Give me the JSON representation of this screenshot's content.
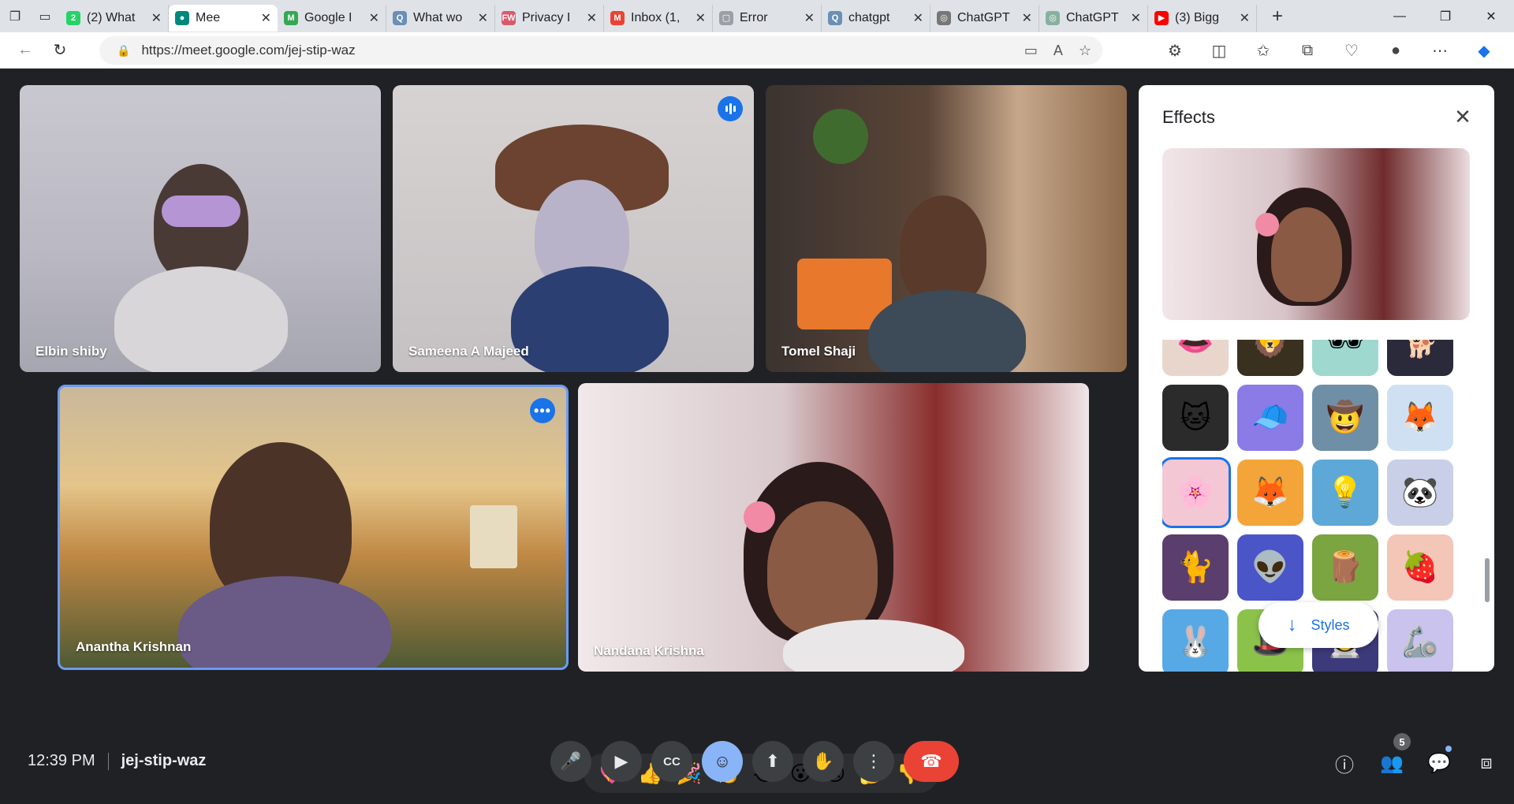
{
  "browser": {
    "tabs": [
      {
        "title": "(2) What",
        "fav": "2",
        "color": "#25d366",
        "active": false
      },
      {
        "title": "Mee",
        "fav": "●",
        "color": "#00897b",
        "active": true
      },
      {
        "title": "Google I",
        "fav": "M",
        "color": "#34a853",
        "active": false
      },
      {
        "title": "What wo",
        "fav": "Q",
        "color": "#6b8fb5",
        "active": false
      },
      {
        "title": "Privacy I",
        "fav": "FW",
        "color": "#d95b6b",
        "active": false
      },
      {
        "title": "Inbox (1,",
        "fav": "M",
        "color": "#ea4335",
        "active": false
      },
      {
        "title": "Error",
        "fav": "▢",
        "color": "#9aa0a6",
        "active": false
      },
      {
        "title": "chatgpt",
        "fav": "Q",
        "color": "#6b8fb5",
        "active": false
      },
      {
        "title": "ChatGPT",
        "fav": "◎",
        "color": "#777777",
        "active": false
      },
      {
        "title": "ChatGPT",
        "fav": "◎",
        "color": "#88b0a0",
        "active": false
      },
      {
        "title": "(3) Bigg",
        "fav": "▶",
        "color": "#ff0000",
        "active": false
      }
    ],
    "url": "https://meet.google.com/jej-stip-waz"
  },
  "tiles": [
    {
      "name": "Elbin shiby"
    },
    {
      "name": "Sameena A Majeed"
    },
    {
      "name": "Tomel Shaji"
    },
    {
      "name": "Anantha Krishnan"
    },
    {
      "name": "Nandana Krishna"
    }
  ],
  "effects": {
    "title": "Effects",
    "styles_label": "Styles",
    "items": [
      {
        "icon": "lips-face",
        "emoji": "👄",
        "bg": "#e8d6cc"
      },
      {
        "icon": "lion-face",
        "emoji": "🦁",
        "bg": "#3a3020"
      },
      {
        "icon": "sunglasses",
        "emoji": "🕶",
        "bg": "#9fd8cf"
      },
      {
        "icon": "dog-face",
        "emoji": "🐕",
        "bg": "#2a2a3a"
      },
      {
        "icon": "cat-face",
        "emoji": "🐱",
        "bg": "#2b2b2b"
      },
      {
        "icon": "cap-hat",
        "emoji": "🧢",
        "bg": "#8a7be6"
      },
      {
        "icon": "cowboy-hat",
        "emoji": "🤠",
        "bg": "#6f8fa6"
      },
      {
        "icon": "flying-fox",
        "emoji": "🦊",
        "bg": "#cfe0f3"
      },
      {
        "icon": "cherry-blossom",
        "emoji": "🌸",
        "bg": "#f3c7d3"
      },
      {
        "icon": "fox-face",
        "emoji": "🦊",
        "bg": "#f3a53a"
      },
      {
        "icon": "lightbulb",
        "emoji": "💡",
        "bg": "#5ea8d8"
      },
      {
        "icon": "panda",
        "emoji": "🐼",
        "bg": "#c8cfe6"
      },
      {
        "icon": "black-cat",
        "emoji": "🐈",
        "bg": "#5a3e6e"
      },
      {
        "icon": "alien-dome",
        "emoji": "👽",
        "bg": "#4a55c8"
      },
      {
        "icon": "tree-stump",
        "emoji": "🪵",
        "bg": "#7aa540"
      },
      {
        "icon": "strawberry",
        "emoji": "🍓",
        "bg": "#f3c6b8"
      },
      {
        "icon": "rabbit",
        "emoji": "🐰",
        "bg": "#57a9e6"
      },
      {
        "icon": "green-hat",
        "emoji": "🎩",
        "bg": "#8bc34a"
      },
      {
        "icon": "astronaut",
        "emoji": "👨‍🚀",
        "bg": "#3c3a7a"
      },
      {
        "icon": "robot-arm",
        "emoji": "🦾",
        "bg": "#c9c3ee"
      }
    ]
  },
  "reactions": [
    "💖",
    "👍",
    "🎉",
    "👏",
    "😂",
    "😮",
    "😢",
    "🤔",
    "👎"
  ],
  "bottom": {
    "time": "12:39 PM",
    "meeting_code": "jej-stip-waz",
    "participant_count": "5"
  }
}
